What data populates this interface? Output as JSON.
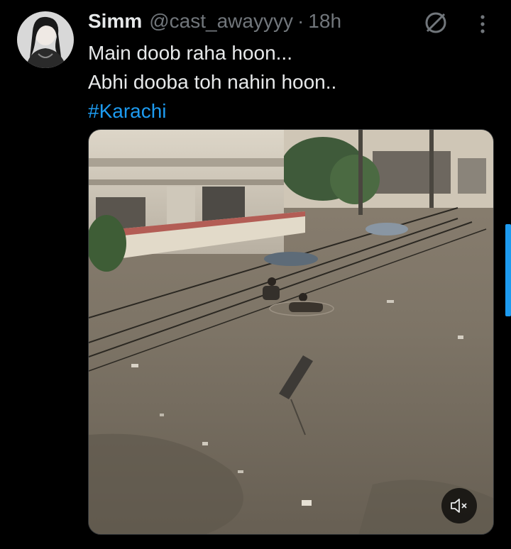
{
  "tweet": {
    "author_name": "Simm",
    "author_handle": "@cast_awayyyy",
    "separator": "·",
    "timestamp": "18h",
    "text_lines": [
      "Main doob raha hoon...",
      "Abhi dooba toh nahin hoon.."
    ],
    "hashtag": "#Karachi"
  },
  "icons": {
    "grok": "grok-icon",
    "more": "more-icon",
    "mute": "volume-muted-icon"
  },
  "colors": {
    "background": "#000000",
    "text": "#e7e9ea",
    "secondary": "#71767b",
    "link": "#1d9bf0"
  }
}
